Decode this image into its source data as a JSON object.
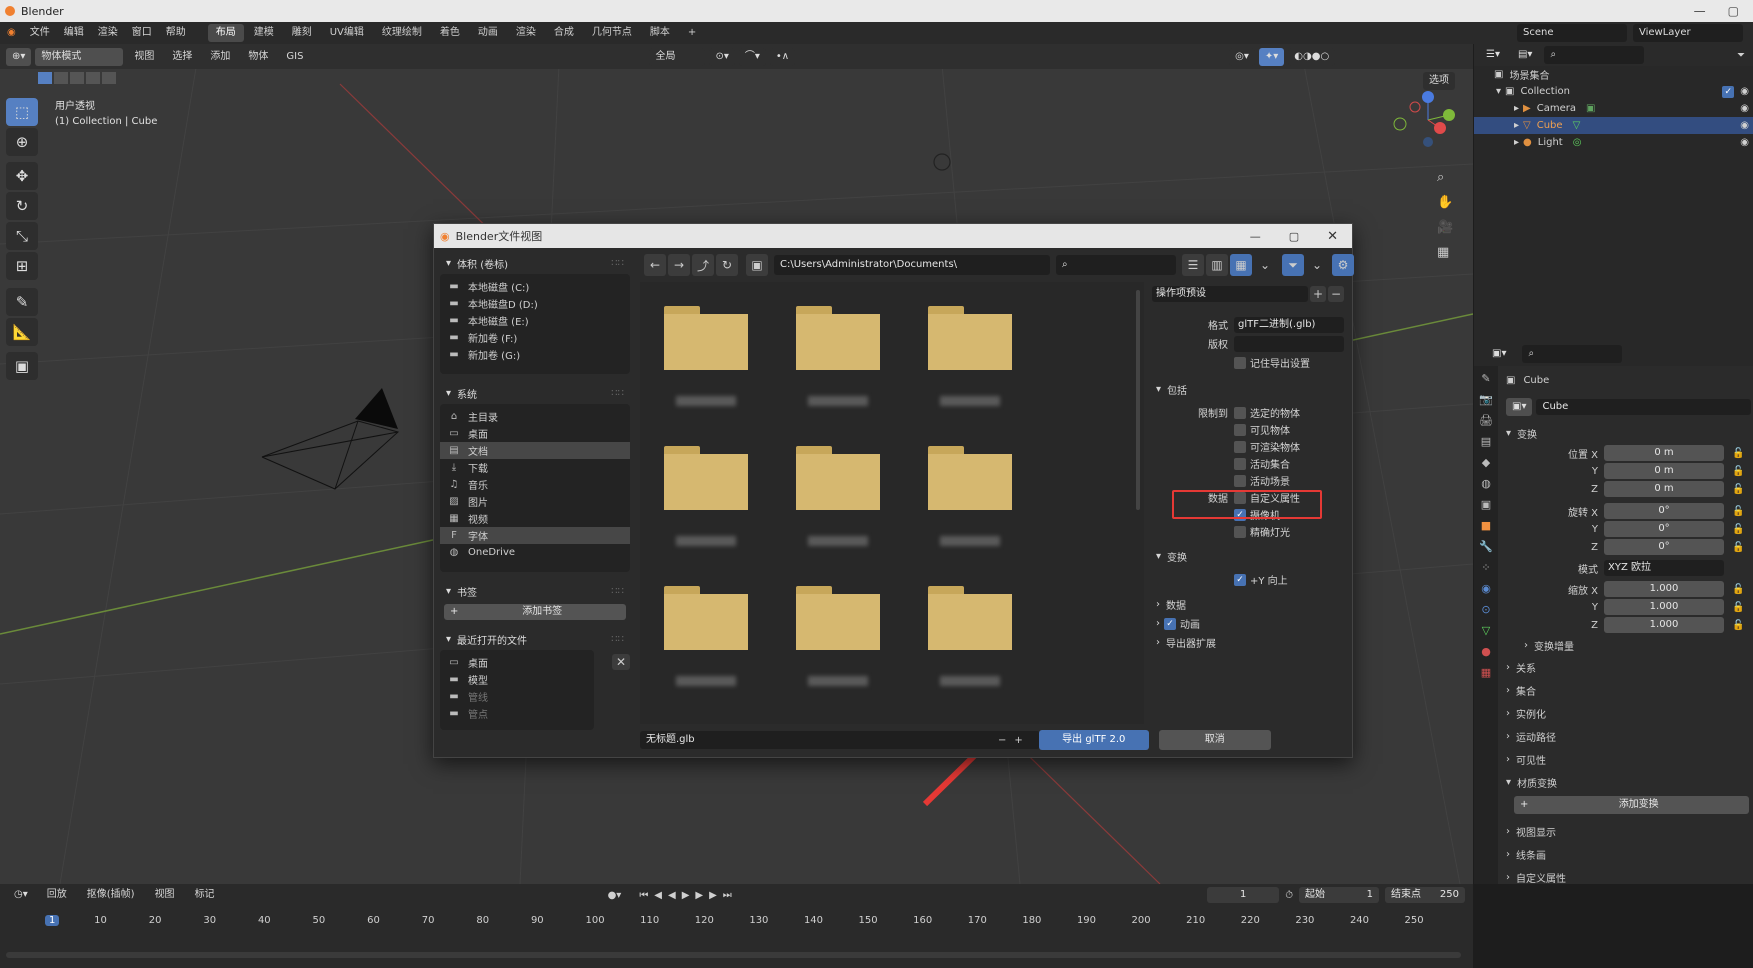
{
  "titlebar": {
    "title": "Blender",
    "min": "—",
    "max": "▢"
  },
  "menu": {
    "items": [
      "文件",
      "编辑",
      "渲染",
      "窗口",
      "帮助"
    ],
    "workspaces": [
      "布局",
      "建模",
      "雕刻",
      "UV编辑",
      "纹理绘制",
      "着色",
      "动画",
      "渲染",
      "合成",
      "几何节点",
      "脚本"
    ],
    "add": "+",
    "scene": "Scene",
    "viewlayer": "ViewLayer"
  },
  "viewport": {
    "mode": "物体模式",
    "menu": [
      "视图",
      "选择",
      "添加",
      "物体",
      "GIS"
    ],
    "orientation": "全局",
    "options": "选项",
    "view_name": "用户透视",
    "collection_info": "(1) Collection | Cube"
  },
  "outliner": {
    "root": "场景集合",
    "collection": "Collection",
    "items": [
      "Camera",
      "Cube",
      "Light"
    ]
  },
  "properties": {
    "object": "Cube",
    "object_data": "Cube",
    "transform": "变换",
    "location_label": "位置 X",
    "loc": [
      "0 m",
      "0 m",
      "0 m"
    ],
    "rotation_label": "旋转 X",
    "rot": [
      "0°",
      "0°",
      "0°"
    ],
    "mode_label": "模式",
    "mode_value": "XYZ 欧拉",
    "scale_label": "缩放 X",
    "scale": [
      "1.000",
      "1.000",
      "1.000"
    ],
    "axes": [
      "Y",
      "Z"
    ],
    "delta": "变换增量",
    "sections": [
      "关系",
      "集合",
      "实例化",
      "运动路径",
      "可见性"
    ],
    "material_transform": "材质变换",
    "add_transform": "添加变换",
    "sections2": [
      "视图显示",
      "线条画",
      "自定义属性"
    ]
  },
  "timeline": {
    "playback": "回放",
    "keying": "抠像(插帧)",
    "view": "视图",
    "marker": "标记",
    "current": "1",
    "start_label": "起始",
    "start": "1",
    "end_label": "结束点",
    "end": "250",
    "ticks": [
      "1",
      "10",
      "20",
      "30",
      "40",
      "50",
      "60",
      "70",
      "80",
      "90",
      "100",
      "110",
      "120",
      "130",
      "140",
      "150",
      "160",
      "170",
      "180",
      "190",
      "200",
      "210",
      "220",
      "230",
      "240",
      "250"
    ]
  },
  "dialog": {
    "title": "Blender文件视图",
    "volumes_header": "体积 (卷标)",
    "volumes": [
      "本地磁盘 (C:)",
      "本地磁盘D (D:)",
      "本地磁盘 (E:)",
      "新加卷 (F:)",
      "新加卷 (G:)"
    ],
    "system_header": "系统",
    "system": [
      "主目录",
      "桌面",
      "文档",
      "下载",
      "音乐",
      "图片",
      "视频",
      "字体",
      "OneDrive"
    ],
    "bookmarks_header": "书签",
    "add_bookmark": "添加书签",
    "recent_header": "最近打开的文件",
    "recent": [
      "桌面",
      "模型",
      "管线",
      "管点"
    ],
    "path": "C:\\Users\\Administrator\\Documents\\",
    "operator_presets": "操作项预设",
    "format_label": "格式",
    "format_value": "glTF二进制(.glb)",
    "copyright_label": "版权",
    "remember": "记住导出设置",
    "include": "包括",
    "limit_label": "限制到",
    "limit_opts": [
      "选定的物体",
      "可见物体",
      "可渲染物体",
      "活动集合",
      "活动场景"
    ],
    "data_label": "数据",
    "data_opts": [
      "自定义属性",
      "摄像机",
      "精确灯光"
    ],
    "transform": "变换",
    "yup": "+Y 向上",
    "data_section": "数据",
    "animation": "动画",
    "export_ext": "导出器扩展",
    "filename": "无标题.glb",
    "export_btn": "导出 glTF 2.0",
    "cancel_btn": "取消"
  },
  "colors": {
    "accent": "#4772b3",
    "highlight": "#e53935",
    "folder": "#d6b870"
  }
}
